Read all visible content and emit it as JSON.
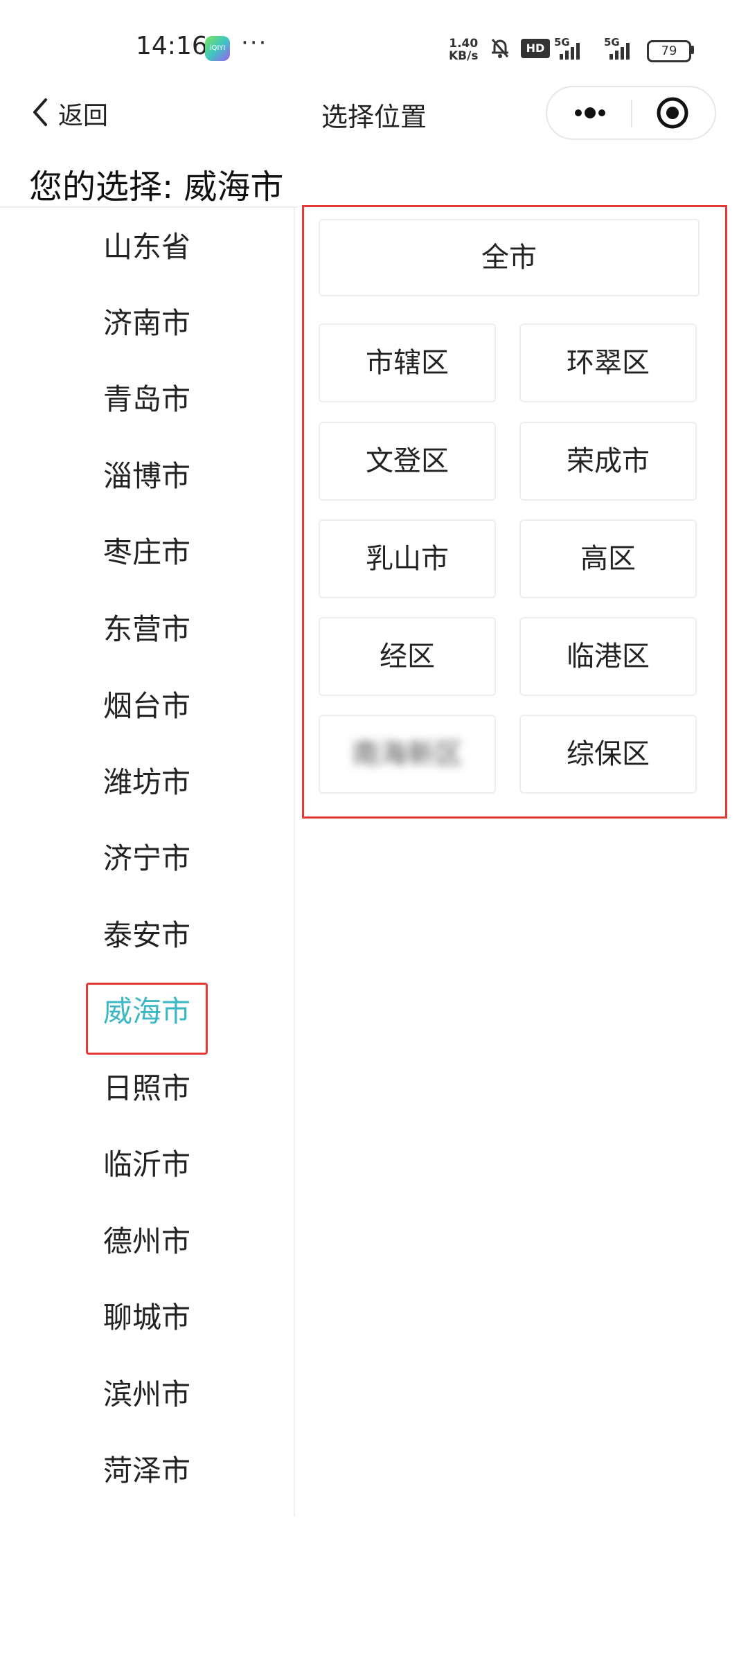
{
  "status_bar": {
    "time": "14:16",
    "app_badge": "iQIYI",
    "dots": "···",
    "speed_value": "1.40",
    "speed_unit": "KB/s",
    "hd": "HD",
    "signal1": "5G",
    "signal2": "5G",
    "battery": "79"
  },
  "nav": {
    "back_label": "返回",
    "title": "选择位置"
  },
  "selection_text": "您的选择: 威海市",
  "cities": [
    {
      "label": "山东省"
    },
    {
      "label": "济南市"
    },
    {
      "label": "青岛市"
    },
    {
      "label": "淄博市"
    },
    {
      "label": "枣庄市"
    },
    {
      "label": "东营市"
    },
    {
      "label": "烟台市"
    },
    {
      "label": "潍坊市"
    },
    {
      "label": "济宁市"
    },
    {
      "label": "泰安市"
    },
    {
      "label": "威海市"
    },
    {
      "label": "日照市"
    },
    {
      "label": "临沂市"
    },
    {
      "label": "德州市"
    },
    {
      "label": "聊城市"
    },
    {
      "label": "滨州市"
    },
    {
      "label": "菏泽市"
    }
  ],
  "selected_city": "威海市",
  "districts": {
    "all": "全市",
    "items": [
      {
        "label": "市辖区"
      },
      {
        "label": "环翠区"
      },
      {
        "label": "文登区"
      },
      {
        "label": "荣成市"
      },
      {
        "label": "乳山市"
      },
      {
        "label": "高区"
      },
      {
        "label": "经区"
      },
      {
        "label": "临港区"
      },
      {
        "label": "南海新区"
      },
      {
        "label": "综保区"
      }
    ]
  },
  "colors": {
    "accent": "#3bb8c3",
    "highlight_box": "#e53935"
  }
}
